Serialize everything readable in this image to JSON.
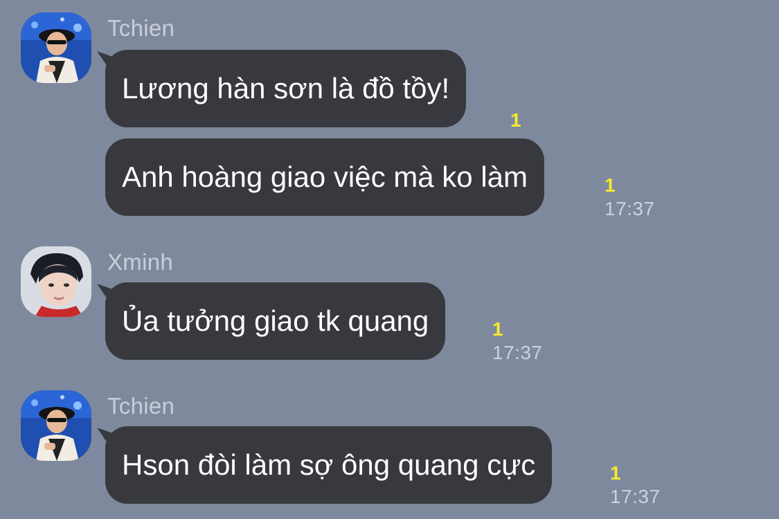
{
  "messages": [
    {
      "sender": "Tchien",
      "bubbles": [
        {
          "text": "Lương hàn sơn là đồ tồy!",
          "unread": "1",
          "time": ""
        },
        {
          "text": "Anh hoàng giao việc mà ko làm",
          "unread": "1",
          "time": "17:37"
        }
      ]
    },
    {
      "sender": "Xminh",
      "bubbles": [
        {
          "text": "Ủa tưởng giao tk quang",
          "unread": "1",
          "time": "17:37"
        }
      ]
    },
    {
      "sender": "Tchien",
      "bubbles": [
        {
          "text": "Hson đòi làm sợ ông quang cực",
          "unread": "1",
          "time": "17:37"
        }
      ]
    }
  ],
  "colors": {
    "background": "#7f899d",
    "bubble": "#38393e",
    "unread": "#f6ea2f",
    "sender": "#c9cfda"
  }
}
